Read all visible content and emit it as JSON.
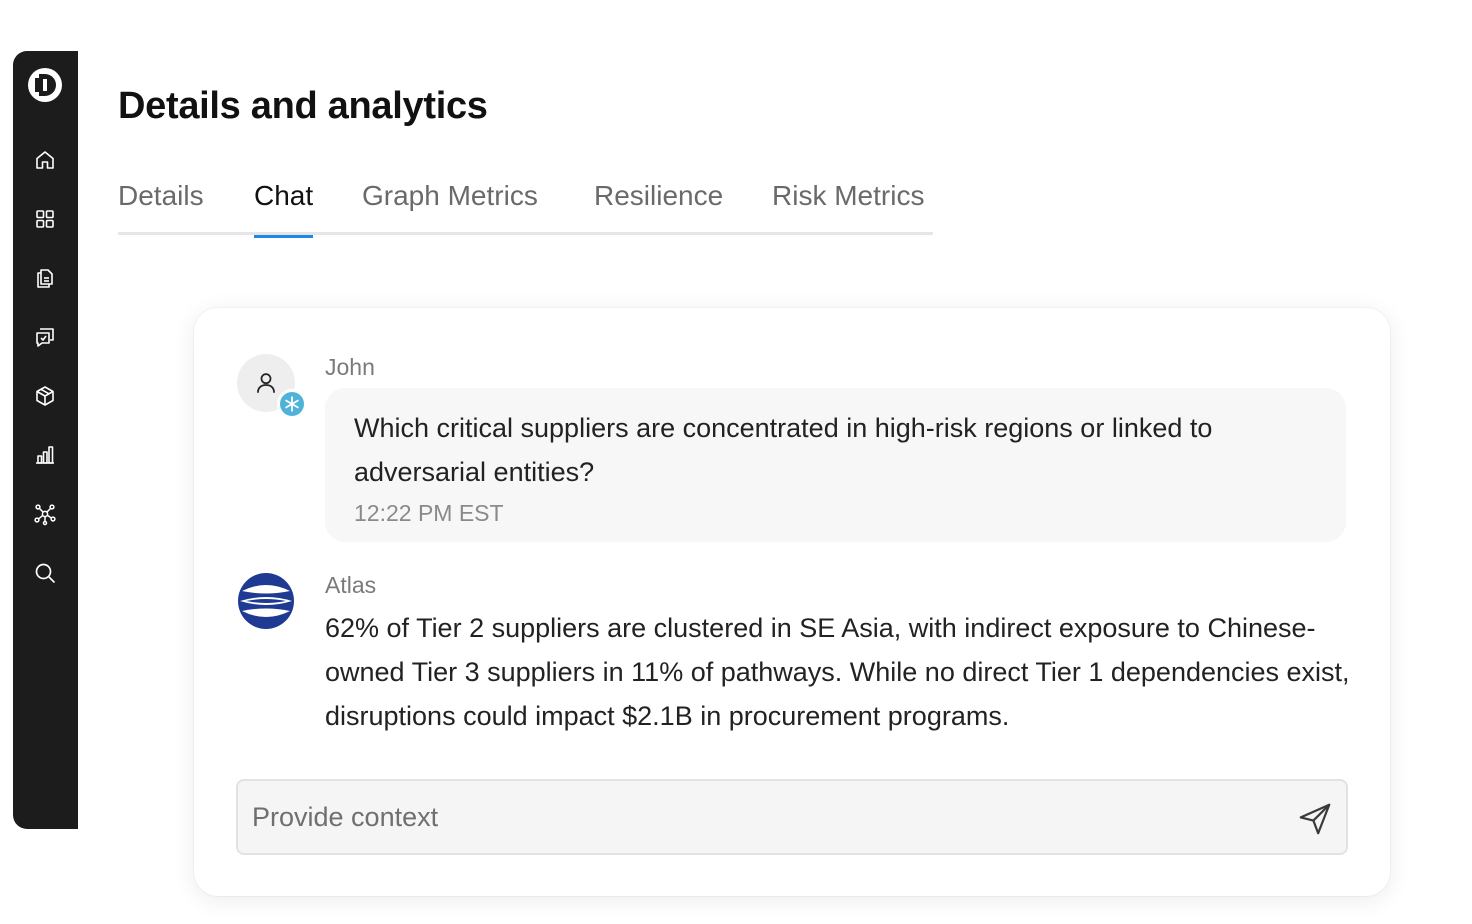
{
  "page": {
    "title": "Details and analytics"
  },
  "sidebar": {
    "logo": "app-logo-icon",
    "items": [
      {
        "icon": "home-icon"
      },
      {
        "icon": "grid-icon"
      },
      {
        "icon": "documents-icon"
      },
      {
        "icon": "chat-history-icon"
      },
      {
        "icon": "box-icon"
      },
      {
        "icon": "bar-chart-icon"
      },
      {
        "icon": "network-graph-icon"
      },
      {
        "icon": "search-icon"
      }
    ]
  },
  "tabs": [
    {
      "label": "Details",
      "active": false
    },
    {
      "label": "Chat",
      "active": true
    },
    {
      "label": "Graph Metrics",
      "active": false
    },
    {
      "label": "Resilience",
      "active": false
    },
    {
      "label": "Risk Metrics",
      "active": false
    }
  ],
  "chat": {
    "messages": [
      {
        "sender": "John",
        "text": "Which critical suppliers are concentrated in high-risk regions or linked to adversarial entities?",
        "time": "12:22 PM EST"
      },
      {
        "sender": "Atlas",
        "text": "62% of Tier 2 suppliers are clustered in SE Asia, with indirect exposure to Chinese-owned Tier 3 suppliers in 11% of pathways. While no direct Tier 1 dependencies exist, disruptions could impact $2.1B in procurement programs."
      }
    ],
    "composer": {
      "placeholder": "Provide context",
      "value": ""
    }
  },
  "colors": {
    "sidebar_bg": "#1c1c1c",
    "tab_active_underline": "#1e88e5",
    "user_badge": "#4fb3d9",
    "atlas_brand": "#1f3a93"
  }
}
